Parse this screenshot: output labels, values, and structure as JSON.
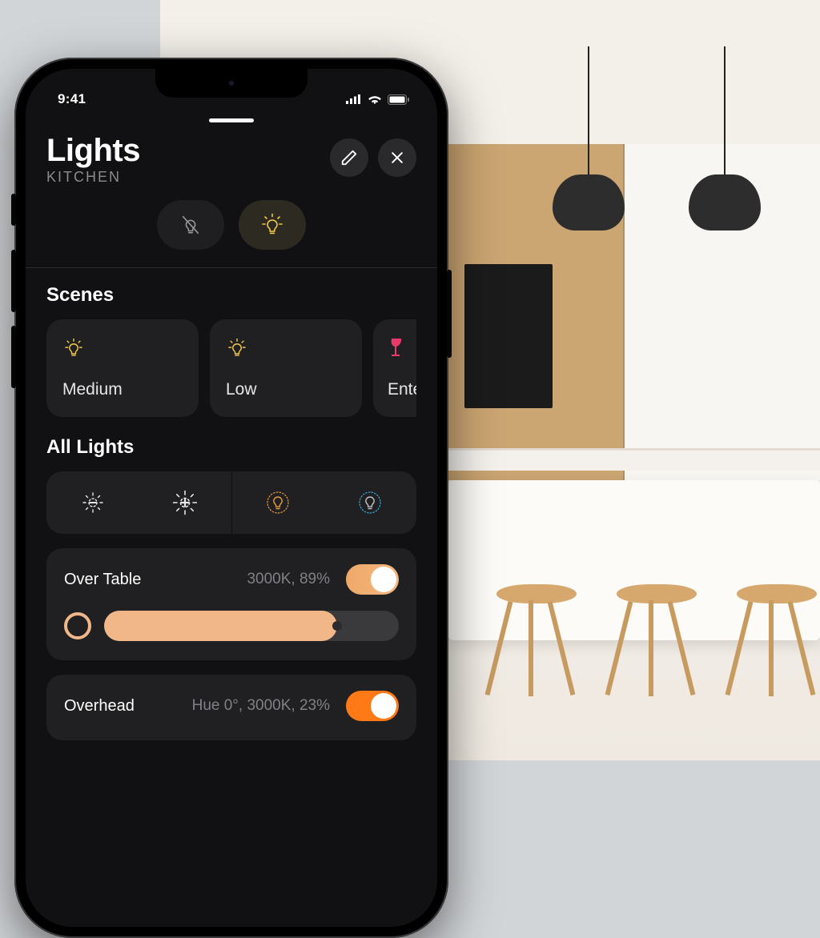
{
  "status_bar": {
    "time": "9:41"
  },
  "header": {
    "title": "Lights",
    "subtitle": "KITCHEN"
  },
  "sections": {
    "scenes_title": "Scenes",
    "all_lights_title": "All Lights"
  },
  "scenes": [
    {
      "label": "Medium",
      "icon": "bulb-on",
      "color": "#f2c94c"
    },
    {
      "label": "Low",
      "icon": "bulb-on",
      "color": "#f2c94c"
    },
    {
      "label": "Enter",
      "icon": "wine-glass",
      "color": "#ea3a6a"
    }
  ],
  "lights": [
    {
      "name": "Over Table",
      "status": "3000K, 89%",
      "on": true,
      "switch_style": "soft",
      "slider_pct": 79,
      "color_ring": "#f2b788"
    },
    {
      "name": "Overhead",
      "status": "Hue 0°, 3000K, 23%",
      "on": true,
      "switch_style": "orange"
    }
  ],
  "colors": {
    "accent_warm": "#f2b788",
    "accent_orange": "#ff7a17",
    "bulb_yellow": "#f2c94c",
    "cool_blue": "#3aa9d6"
  }
}
